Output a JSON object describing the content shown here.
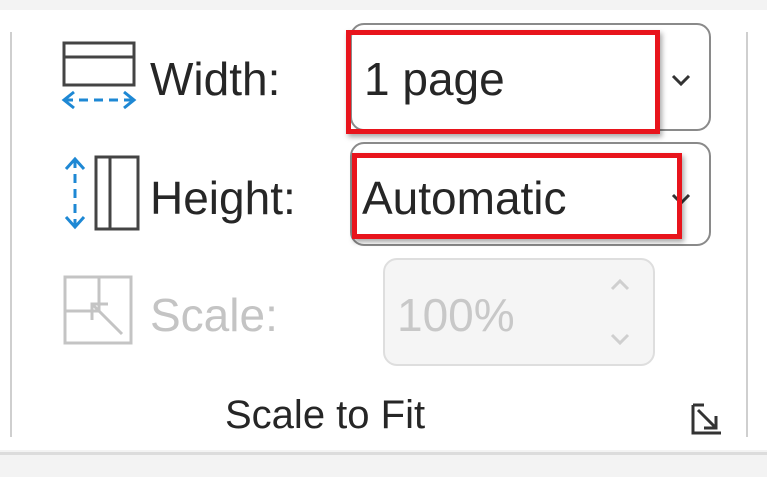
{
  "group": {
    "title": "Scale to Fit",
    "launcher_icon": "dialog-launcher-icon"
  },
  "width_row": {
    "icon": "page-width-icon",
    "label": "Width:",
    "value": "1 page",
    "arrow_icon": "chevron-down-icon"
  },
  "height_row": {
    "icon": "page-height-icon",
    "label": "Height:",
    "value": "Automatic",
    "arrow_icon": "chevron-down-icon"
  },
  "scale_row": {
    "icon": "scale-icon",
    "label": "Scale:",
    "value": "100%",
    "enabled": false
  },
  "colors": {
    "highlight": "#e8141c",
    "icon_blue": "#1e88d4",
    "disabled": "#c4c4c4"
  }
}
